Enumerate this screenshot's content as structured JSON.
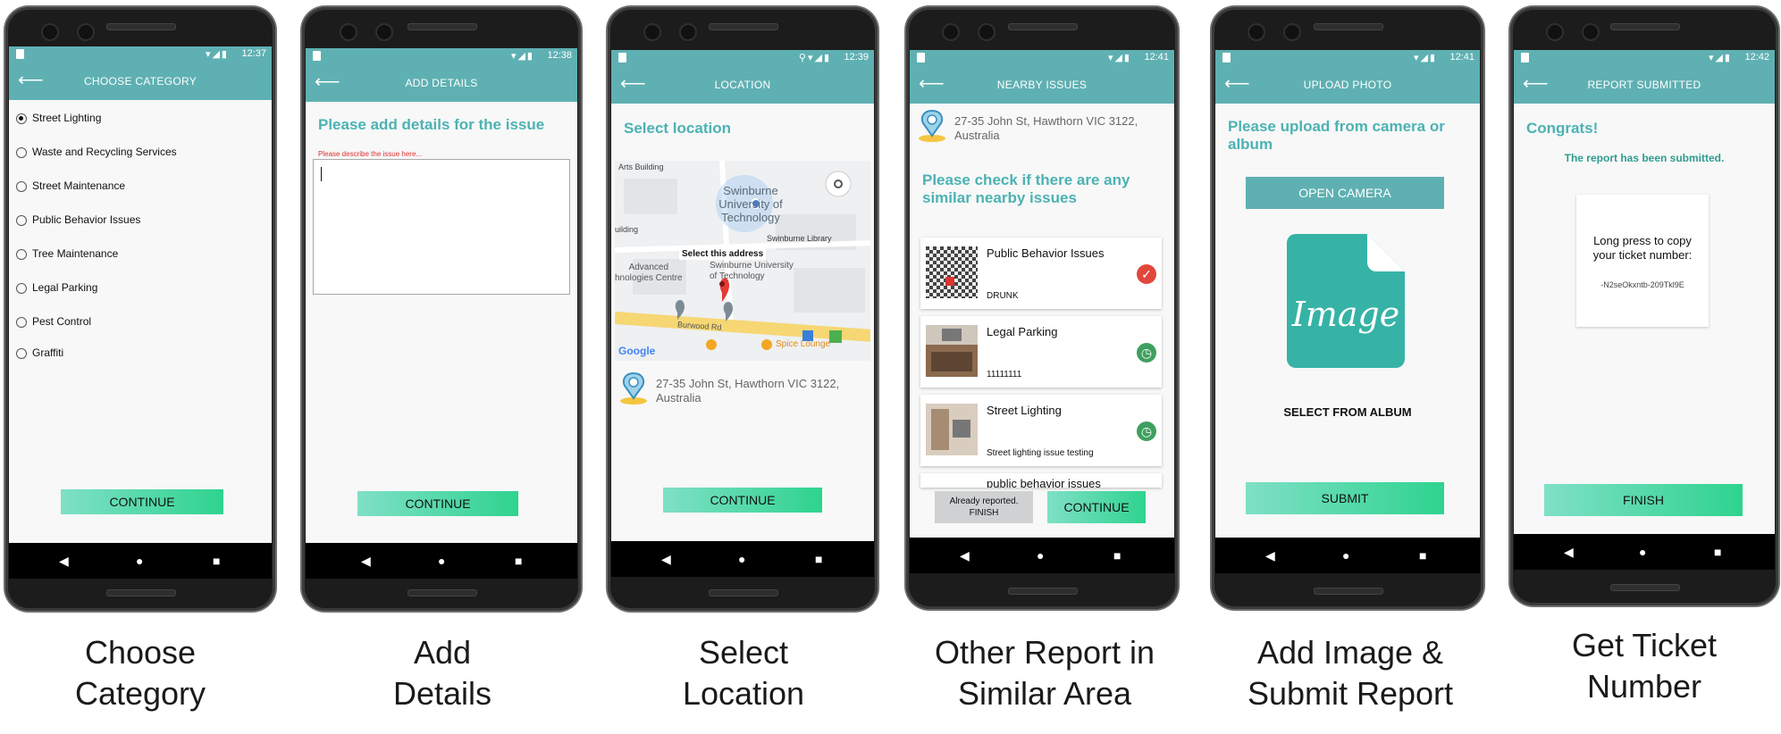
{
  "screens": [
    {
      "status_time": "12:37",
      "title": "CHOOSE CATEGORY",
      "categories": [
        {
          "label": "Street Lighting",
          "selected": true
        },
        {
          "label": "Waste and Recycling Services",
          "selected": false
        },
        {
          "label": "Street Maintenance",
          "selected": false
        },
        {
          "label": "Public Behavior Issues",
          "selected": false
        },
        {
          "label": "Tree Maintenance",
          "selected": false
        },
        {
          "label": "Legal Parking",
          "selected": false
        },
        {
          "label": "Pest Control",
          "selected": false
        },
        {
          "label": "Graffiti",
          "selected": false
        }
      ],
      "continue_label": "CONTINUE",
      "caption": "Choose\nCategory"
    },
    {
      "status_time": "12:38",
      "title": "ADD DETAILS",
      "heading": "Please add details for the issue",
      "field_hint": "Please describe the issue here...",
      "continue_label": "CONTINUE",
      "caption": "Add\nDetails"
    },
    {
      "status_time": "12:39",
      "title": "LOCATION",
      "heading": "Select location",
      "map": {
        "label_arts": "Arts Building",
        "label_uni": "Swinburne\nUniversity of\nTechnology",
        "label_building": "uilding",
        "label_library": "Swinburne Library",
        "label_select": "Select this address",
        "label_advanced": "Advanced\nhnologies Centre",
        "label_uni2": "Swinburne University\nof Technology",
        "label_road": "Burwood Rd",
        "label_spice": "Spice Lounge",
        "label_google": "Google"
      },
      "address": "27-35 John St, Hawthorn VIC 3122,\nAustralia",
      "continue_label": "CONTINUE",
      "caption": "Select\nLocation"
    },
    {
      "status_time": "12:41",
      "title": "NEARBY ISSUES",
      "address": "27-35 John St, Hawthorn VIC 3122,\nAustralia",
      "heading": "Please check if there are any\nsimilar nearby issues",
      "issues": [
        {
          "title": "Public Behavior Issues",
          "desc": "DRUNK",
          "status": "check",
          "color": "#e0483b"
        },
        {
          "title": "Legal Parking",
          "desc": "11111111",
          "status": "clock",
          "color": "#3fa05e"
        },
        {
          "title": "Street Lighting",
          "desc": "Street lighting issue testing",
          "status": "clock",
          "color": "#3fa05e"
        },
        {
          "title": "public behavior issues",
          "desc": "",
          "status": "",
          "color": ""
        }
      ],
      "already_label": "Already reported.\nFINISH",
      "continue_label": "CONTINUE",
      "caption": "Other Report in\nSimilar Area"
    },
    {
      "status_time": "12:41",
      "title": "UPLOAD PHOTO",
      "heading": "Please upload from camera or\nalbum",
      "camera_label": "OPEN CAMERA",
      "image_label": "Image",
      "album_label": "SELECT FROM ALBUM",
      "submit_label": "SUBMIT",
      "caption": "Add Image &\nSubmit Report"
    },
    {
      "status_time": "12:42",
      "title": "REPORT SUBMITTED",
      "heading": "Congrats!",
      "subheading": "The report has been submitted.",
      "ticket_prompt": "Long press to copy\nyour ticket number:",
      "ticket_number": "-N2seOkxntb-209Tkl9E",
      "finish_label": "FINISH",
      "caption": "Get Ticket\nNumber"
    }
  ],
  "colors": {
    "appbar": "#5fb0b2",
    "accent": "#4db2b4",
    "button_start": "#7fe0c6",
    "button_end": "#2fd38f"
  }
}
